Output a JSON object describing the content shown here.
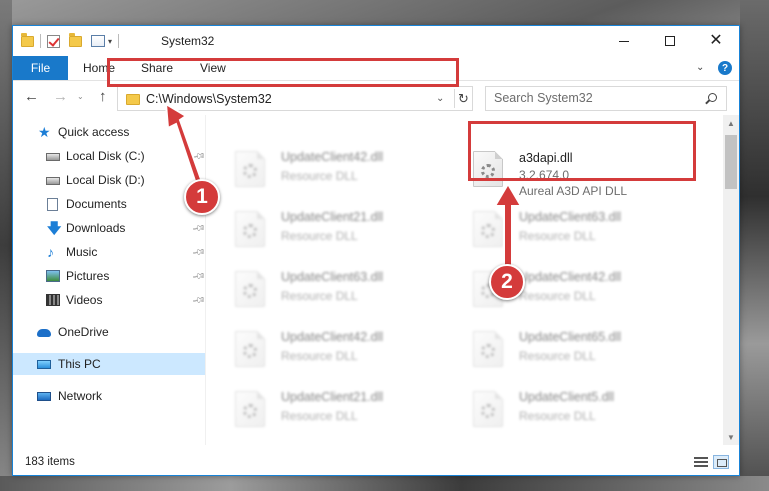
{
  "window": {
    "title": "System32",
    "tabs": {
      "file": "File",
      "home": "Home",
      "share": "Share",
      "view": "View"
    },
    "help": "?"
  },
  "nav": {
    "address": "C:\\Windows\\System32",
    "search_placeholder": "Search System32"
  },
  "sidebar": {
    "items": [
      {
        "label": "Quick access",
        "icon": "star-icon"
      },
      {
        "label": "Local Disk (C:)",
        "icon": "disk-icon",
        "pinned": true
      },
      {
        "label": "Local Disk (D:)",
        "icon": "disk-icon"
      },
      {
        "label": "Documents",
        "icon": "documents-icon"
      },
      {
        "label": "Downloads",
        "icon": "download-icon",
        "pinned": true
      },
      {
        "label": "Music",
        "icon": "music-icon",
        "pinned": true
      },
      {
        "label": "Pictures",
        "icon": "pictures-icon",
        "pinned": true
      },
      {
        "label": "Videos",
        "icon": "videos-icon",
        "pinned": true
      },
      {
        "label": "OneDrive",
        "icon": "cloud-icon"
      },
      {
        "label": "This PC",
        "icon": "pc-icon",
        "selected": true
      },
      {
        "label": "Network",
        "icon": "network-icon"
      }
    ]
  },
  "files": {
    "left_column": [
      {
        "name": "UpdateClient42.dll",
        "type": "Resource DLL"
      },
      {
        "name": "UpdateClient21.dll",
        "type": "Resource DLL"
      },
      {
        "name": "UpdateClient63.dll",
        "type": "Resource DLL"
      },
      {
        "name": "UpdateClient42.dll",
        "type": "Resource DLL"
      },
      {
        "name": "UpdateClient21.dll",
        "type": "Resource DLL"
      }
    ],
    "target": {
      "name": "a3dapi.dll",
      "version": "3.2.674.0",
      "description": "Aureal A3D API DLL"
    },
    "right_column": [
      {
        "name": "UpdateClient63.dll",
        "type": "Resource DLL"
      },
      {
        "name": "UpdateClient42.dll",
        "type": "Resource DLL"
      },
      {
        "name": "UpdateClient65.dll",
        "type": "Resource DLL"
      },
      {
        "name": "UpdateClient5.dll",
        "type": "Resource DLL"
      }
    ]
  },
  "status": {
    "count": "183 items"
  },
  "callouts": {
    "one": "1",
    "two": "2"
  },
  "colors": {
    "accent": "#1979ca",
    "highlight": "#d43b3b",
    "selected": "#cce8ff"
  }
}
